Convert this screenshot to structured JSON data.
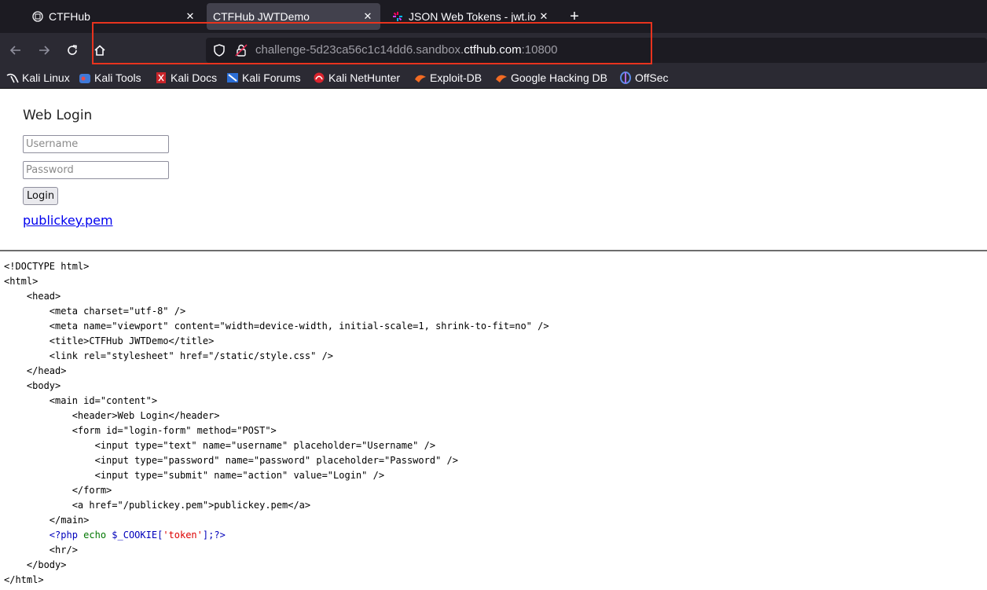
{
  "browser": {
    "tabs": [
      {
        "title": "CTFHub",
        "favicon": "globe-icon",
        "active": false
      },
      {
        "title": "CTFHub JWTDemo",
        "favicon": "none",
        "active": true
      },
      {
        "title": "JSON Web Tokens - jwt.io",
        "favicon": "jwt-icon",
        "active": false
      }
    ],
    "url": {
      "prefix": "challenge-5d23ca56c1c14dd6.sandbox.",
      "domain": "ctfhub.com",
      "suffix": ":10800"
    },
    "bookmarks": [
      {
        "label": "Kali Linux",
        "icon": "kali-dragon-icon"
      },
      {
        "label": "Kali Tools",
        "icon": "kali-tools-icon"
      },
      {
        "label": "Kali Docs",
        "icon": "kali-docs-icon"
      },
      {
        "label": "Kali Forums",
        "icon": "kali-forums-icon"
      },
      {
        "label": "Kali NetHunter",
        "icon": "nethunter-icon"
      },
      {
        "label": "Exploit-DB",
        "icon": "exploit-db-icon"
      },
      {
        "label": "Google Hacking DB",
        "icon": "ghdb-icon"
      },
      {
        "label": "OffSec",
        "icon": "offsec-icon"
      }
    ],
    "highlight_color": "#e8331e"
  },
  "page": {
    "title": "Web Login",
    "username_placeholder": "Username",
    "password_placeholder": "Password",
    "login_label": "Login",
    "link_label": "publickey.pem"
  },
  "source_lines": [
    "<!DOCTYPE html>",
    "<html>",
    "    <head>",
    "        <meta charset=\"utf-8\" />",
    "        <meta name=\"viewport\" content=\"width=device-width, initial-scale=1, shrink-to-fit=no\" />",
    "        <title>CTFHub JWTDemo</title>",
    "        <link rel=\"stylesheet\" href=\"/static/style.css\" />",
    "    </head>",
    "    <body>",
    "        <main id=\"content\">",
    "            <header>Web Login</header>",
    "            <form id=\"login-form\" method=\"POST\">",
    "                <input type=\"text\" name=\"username\" placeholder=\"Username\" />",
    "                <input type=\"password\" name=\"password\" placeholder=\"Password\" />",
    "                <input type=\"submit\" name=\"action\" value=\"Login\" />",
    "            </form>",
    "            <a href=\"/publickey.pem\">publickey.pem</a>",
    "        </main>",
    "        ",
    "        <hr/>",
    "    </body>",
    "</html>"
  ],
  "php_line": {
    "indent": "        ",
    "open": "<?php",
    "echo": " echo ",
    "var": "$_COOKIE[",
    "str": "'token'",
    "close": "];?>"
  }
}
